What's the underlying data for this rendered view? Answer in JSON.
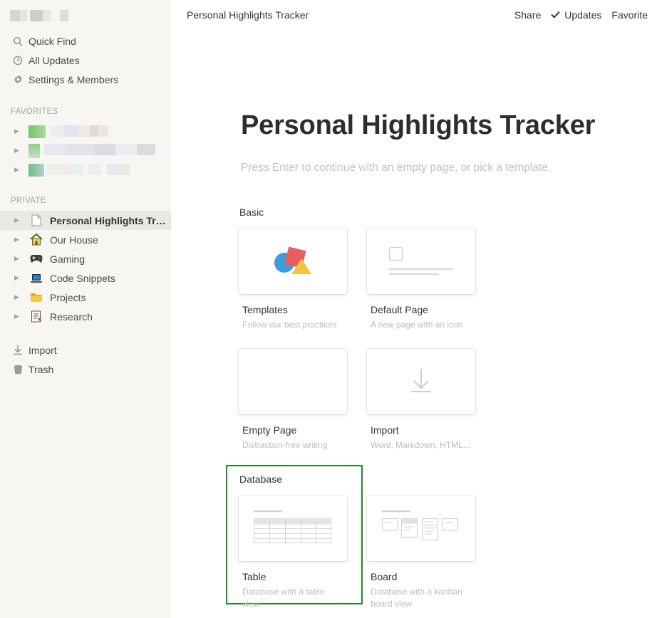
{
  "sidebar": {
    "nav": [
      {
        "label": "Quick Find",
        "icon": "search-icon"
      },
      {
        "label": "All Updates",
        "icon": "clock-icon"
      },
      {
        "label": "Settings & Members",
        "icon": "gear-icon"
      }
    ],
    "favorites_label": "FAVORITES",
    "private_label": "PRIVATE",
    "private_items": [
      {
        "label": "Personal Highlights Trac...",
        "icon": "page-icon"
      },
      {
        "label": "Our House",
        "icon": "house-icon"
      },
      {
        "label": "Gaming",
        "icon": "gamepad-icon"
      },
      {
        "label": "Code Snippets",
        "icon": "laptop-icon"
      },
      {
        "label": "Projects",
        "icon": "folder-icon"
      },
      {
        "label": "Research",
        "icon": "document-icon"
      }
    ],
    "bottom": [
      {
        "label": "Import",
        "icon": "import-icon"
      },
      {
        "label": "Trash",
        "icon": "trash-icon"
      }
    ]
  },
  "topbar": {
    "breadcrumb": "Personal Highlights Tracker",
    "share": "Share",
    "updates": "Updates",
    "favorite": "Favorite"
  },
  "main": {
    "title": "Personal Highlights Tracker",
    "prompt": "Press Enter to continue with an empty page, or pick a template.",
    "basic_label": "Basic",
    "database_label": "Database",
    "cards": {
      "templates": {
        "title": "Templates",
        "desc": "Follow our best practices"
      },
      "default_page": {
        "title": "Default Page",
        "desc": "A new page with an icon"
      },
      "empty_page": {
        "title": "Empty Page",
        "desc": "Distraction-free writing"
      },
      "import": {
        "title": "Import",
        "desc": "Word, Markdown, HTML..."
      },
      "table": {
        "title": "Table",
        "desc": "Database with a table view."
      },
      "board": {
        "title": "Board",
        "desc": "Database with a kanban board view."
      }
    }
  },
  "colors": {
    "sidebar_bg": "#f7f6f3",
    "highlight_border": "#1f8a1f",
    "template_red": "#e85d5d",
    "template_blue": "#3f9bd9",
    "template_yellow": "#f5c244"
  }
}
